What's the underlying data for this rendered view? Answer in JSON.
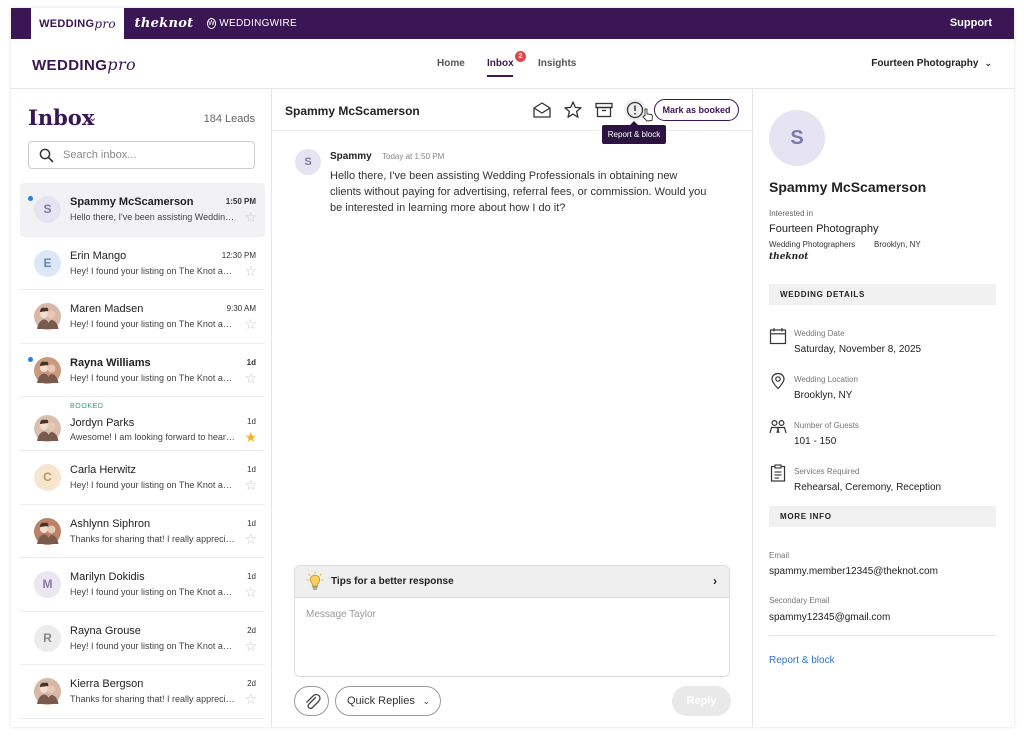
{
  "brandbar": {
    "weddingpro_tab": {
      "main": "WEDDING",
      "pro": "pro"
    },
    "theknot_tab": "theknot",
    "weddingwire_tab": "WEDDINGWIRE",
    "support": "Support"
  },
  "nav": {
    "logo": {
      "main": "WEDDING",
      "pro": "pro"
    },
    "home": "Home",
    "inbox": "Inbox",
    "inbox_badge": "2",
    "insights": "Insights",
    "vendor": "Fourteen Photography"
  },
  "inbox": {
    "title": "Inbox",
    "lead_count": "184 Leads",
    "search_placeholder": "Search inbox...",
    "leads": [
      {
        "initial": "S",
        "name": "Spammy McScamerson",
        "time": "1:50 PM",
        "preview": "Hello there, I've been assisting Wedding Professionals",
        "unread": true,
        "selected": true,
        "starred": false
      },
      {
        "initial": "E",
        "name": "Erin Mango",
        "time": "12:30 PM",
        "preview": "Hey! I found your listing on The Knot and would love to",
        "unread": false,
        "starred": false
      },
      {
        "initial": "",
        "name": "Maren Madsen",
        "time": "9:30 AM",
        "preview": "Hey! I found your listing on The Knot and would love to",
        "unread": false,
        "starred": false
      },
      {
        "initial": "",
        "name": "Rayna Williams",
        "time": "1d",
        "preview": "Hey! I found your listing on The Knot and would love to",
        "unread": true,
        "starred": false
      },
      {
        "initial": "",
        "name": "Jordyn Parks",
        "time": "1d",
        "preview": "Awesome! I am looking forward to hearing from you",
        "booked_label": "BOOKED",
        "unread": false,
        "starred": true
      },
      {
        "initial": "C",
        "name": "Carla Herwitz",
        "time": "1d",
        "preview": "Hey! I found your listing on The Knot and would love to",
        "unread": false,
        "starred": false
      },
      {
        "initial": "",
        "name": "Ashlynn Siphron",
        "time": "1d",
        "preview": "Thanks for sharing that! I really appreciate it",
        "unread": false,
        "starred": false
      },
      {
        "initial": "M",
        "name": "Marilyn Dokidis",
        "time": "1d",
        "preview": "Hey! I found your listing on The Knot and would love to",
        "unread": false,
        "starred": false
      },
      {
        "initial": "R",
        "name": "Rayna Grouse",
        "time": "2d",
        "preview": "Hey! I found your listing on The Knot and would love to",
        "unread": false,
        "starred": false
      },
      {
        "initial": "",
        "name": "Kierra Bergson",
        "time": "2d",
        "preview": "Thanks for sharing that! I really appreciate it",
        "unread": false,
        "starred": false
      }
    ]
  },
  "conversation": {
    "name": "Spammy McScamerson",
    "mark_booked": "Mark as booked",
    "tooltip": "Report & block",
    "message": {
      "avatar": "S",
      "from": "Spammy",
      "time": "Today at 1:50 PM",
      "body": "Hello there, I've been assisting Wedding Professionals in obtaining new clients without paying for advertising, referral fees, or commission. Would you be interested in learning more about how I do it?"
    },
    "tips": "Tips for a better response",
    "message_placeholder": "Message Taylor",
    "quick_replies": "Quick Replies",
    "reply": "Reply"
  },
  "details": {
    "avatar": "S",
    "name": "Spammy McScamerson",
    "interested_label": "Interested in",
    "business": "Fourteen Photography",
    "category": "Wedding Photographers",
    "location": "Brooklyn, NY",
    "source": "theknot",
    "wedding_details_header": "WEDDING DETAILS",
    "wedding_date_label": "Wedding Date",
    "wedding_date": "Saturday, November 8, 2025",
    "wedding_location_label": "Wedding Location",
    "wedding_location": "Brooklyn, NY",
    "guests_label": "Number of Guests",
    "guests": "101 - 150",
    "services_label": "Services Required",
    "services": "Rehearsal, Ceremony, Reception",
    "more_info_header": "MORE INFO",
    "email_label": "Email",
    "email": "spammy.member12345@theknot.com",
    "secondary_email_label": "Secondary Email",
    "secondary_email": "spammy12345@gmail.com",
    "report_block": "Report & block"
  },
  "colors": {
    "brand_purple": "#3a1654",
    "badge_red": "#e0454b",
    "unread_dot": "#2d7ee0",
    "booked_green": "#2aa072",
    "star_gold": "#f0b42a",
    "link_blue": "#2f73c9",
    "avatar_lavender": "#e6e4f3"
  }
}
